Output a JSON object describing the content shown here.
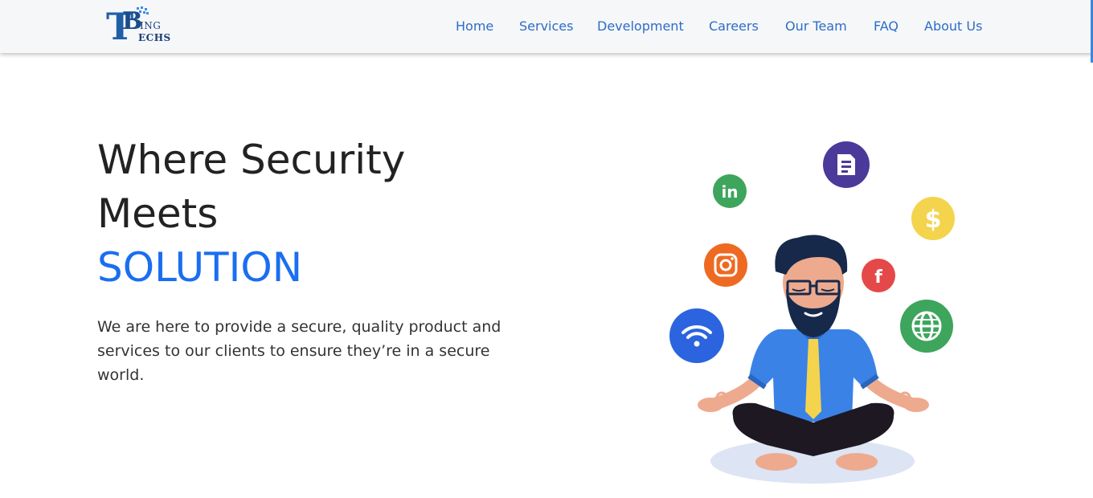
{
  "header": {
    "logo": {
      "letter_t": "T",
      "letter_b": "B",
      "line1": "ING",
      "line2": "ECHS"
    },
    "nav_items": [
      {
        "label": "Home"
      },
      {
        "label": "Services"
      },
      {
        "label": "Development"
      },
      {
        "label": "Careers"
      },
      {
        "label": "Our Team"
      },
      {
        "label": "FAQ"
      },
      {
        "label": "About Us"
      }
    ],
    "nav_color": "#2c6dc7"
  },
  "hero": {
    "title_line1": "Where Security",
    "title_line2": "Meets",
    "title_accent": "SOLUTION",
    "description": "We are here to provide a secure, quality product and services to our clients to ensure they’re in a secure world.",
    "accent_color": "#1a6ef0"
  },
  "illustration": {
    "subject": "meditating man surrounded by floating icons",
    "icons": [
      {
        "name": "document-icon",
        "color": "#4b3a9a"
      },
      {
        "name": "linkedin-icon",
        "color": "#3ea55c"
      },
      {
        "name": "dollar-icon",
        "color": "#f4d44d"
      },
      {
        "name": "instagram-icon",
        "color": "#ee6a22"
      },
      {
        "name": "facebook-icon",
        "color": "#e44848"
      },
      {
        "name": "wifi-icon",
        "color": "#2b64de"
      },
      {
        "name": "globe-icon",
        "color": "#3ea55c"
      }
    ]
  }
}
